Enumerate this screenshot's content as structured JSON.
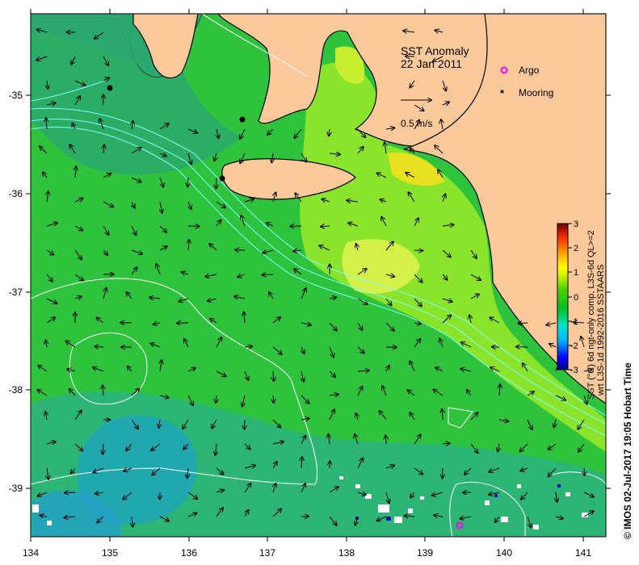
{
  "title": "SST Anomaly",
  "date": "22 Jan 2011",
  "legend": {
    "argo_label": "Argo",
    "argo_color": "#ff00ff",
    "mooring_label": "Mooring",
    "mooring_color": "#000000",
    "vector_scale_label": "0.5 m/s"
  },
  "colorbar": {
    "title_line1": "SST (°C) 6d ngt-only comp, L3S-6d QL>=2",
    "title_line2": "wrt L3S-1d 1992-2016 SSTAARS",
    "ticks": [
      "3",
      "2",
      "1",
      "0",
      "-1",
      "-2",
      "-3"
    ],
    "stops": [
      "#00007f",
      "#0000ff",
      "#00b4ff",
      "#00e5c8",
      "#00c020",
      "#4cd000",
      "#c8f000",
      "#ffff00",
      "#ffa000",
      "#ff3000",
      "#a00000",
      "#700000"
    ]
  },
  "axes": {
    "x_ticks": [
      "134",
      "135",
      "136",
      "137",
      "138",
      "139",
      "140",
      "141"
    ],
    "y_ticks": [
      "-35",
      "-36",
      "-37",
      "-38",
      "-39"
    ]
  },
  "colors": {
    "land": "#fcc99b",
    "sea_base": "#2fc23c",
    "sea_warm": "#8ee62a",
    "sea_cool": "#1fae78"
  },
  "credit": "© IMOS 02-Jul-2017 19:05 Hobart Time"
}
